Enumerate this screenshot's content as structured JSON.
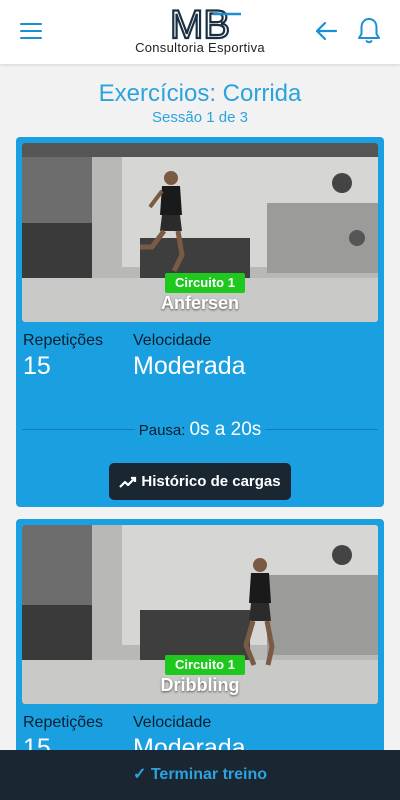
{
  "header": {
    "logo_text": "MB",
    "logo_subtitle": "Consultoria Esportiva",
    "menu_icon": "hamburger-menu-icon",
    "back_icon": "arrow-left-icon",
    "notifications_icon": "bell-icon"
  },
  "page": {
    "title": "Exercícios: Corrida",
    "session": "Sessão 1 de 3"
  },
  "exercises": [
    {
      "circuit": "Circuito 1",
      "name": "Anfersen",
      "reps_label": "Repetições",
      "reps": "15",
      "speed_label": "Velocidade",
      "speed": "Moderada",
      "pause_label": "Pausa:",
      "pause": "0s a 20s",
      "history_button": "Histórico de cargas"
    },
    {
      "circuit": "Circuito 1",
      "name": "Dribbling",
      "reps_label": "Repetições",
      "reps": "15",
      "speed_label": "Velocidade",
      "speed": "Moderada"
    }
  ],
  "footer": {
    "finish_label": "✓ Terminar treino"
  },
  "colors": {
    "accent": "#2ca3dd",
    "card": "#1aa0e0",
    "dark": "#1b2633",
    "circuit_badge": "#1ec81e"
  }
}
